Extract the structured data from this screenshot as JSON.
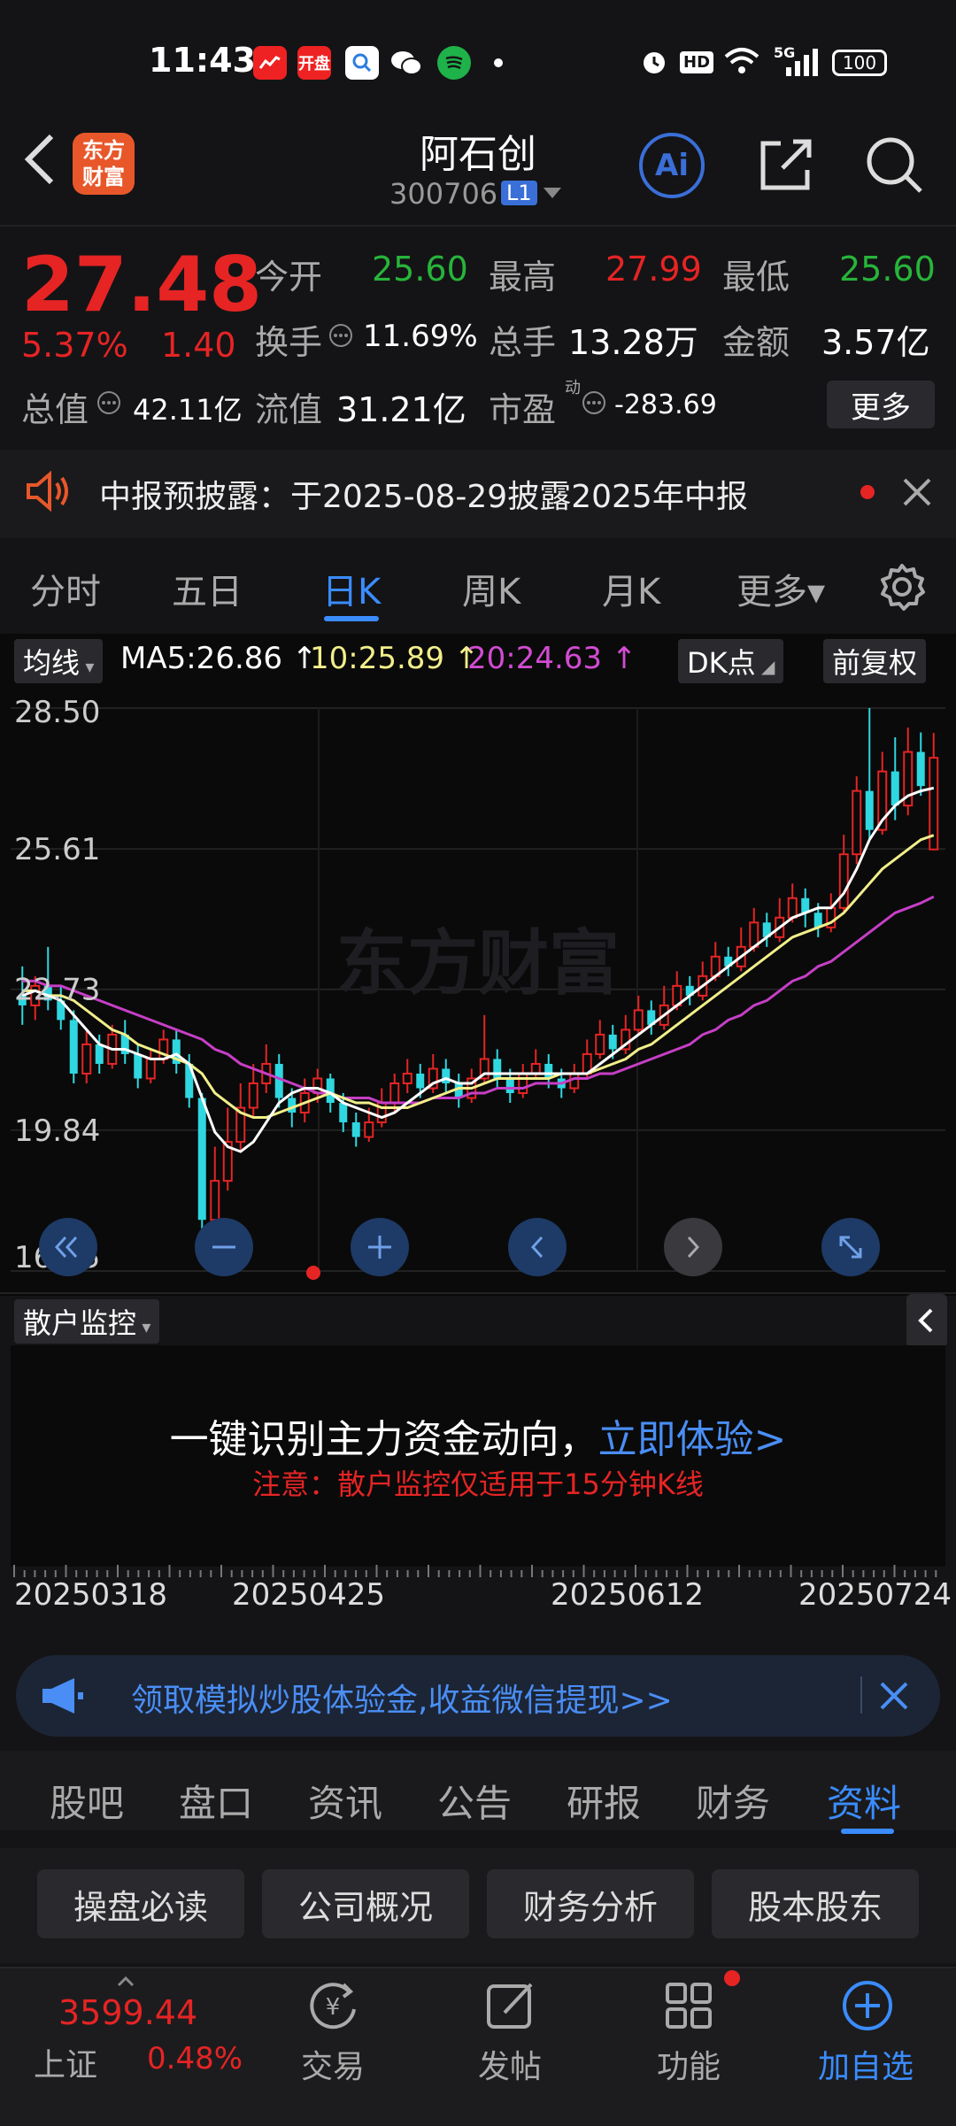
{
  "status_bar": {
    "time": "11:43",
    "apps": [
      "开盘"
    ],
    "battery": "100",
    "hd": "HD",
    "signal": "5G"
  },
  "header": {
    "back_icon": "chevron-left-icon",
    "logo": "东方\n财富",
    "stock_name": "阿石创",
    "stock_code": "300706",
    "level_badge": "L1"
  },
  "quote": {
    "price": "27.48",
    "change_pct": "5.37%",
    "change_amt": "1.40",
    "today_open_label": "今开",
    "today_open": "25.60",
    "high_label": "最高",
    "high": "27.99",
    "low_label": "最低",
    "low": "25.60",
    "turnover_label": "换手",
    "turnover": "11.69%",
    "volume_label": "总手",
    "volume": "13.28万",
    "amount_label": "金额",
    "amount": "3.57亿",
    "total_mv_label": "总值",
    "total_mv": "42.11亿",
    "float_mv_label": "流值",
    "float_mv": "31.21亿",
    "pe_label": "市盈",
    "pe_sup": "动",
    "pe": "-283.69",
    "more": "更多"
  },
  "notice": {
    "text": "中报预披露：于2025-08-29披露2025年中报"
  },
  "chart_tabs": [
    {
      "label": "分时"
    },
    {
      "label": "五日"
    },
    {
      "label": "日K"
    },
    {
      "label": "周K"
    },
    {
      "label": "月K"
    },
    {
      "label": "更多▾"
    }
  ],
  "ma_bar": {
    "selector": "均线",
    "ma5": "MA5:26.86",
    "ma10": "10:25.89",
    "ma20": "20:24.63",
    "dk": "DK点",
    "adjust": "前复权"
  },
  "colors": {
    "up": "#e62424",
    "down": "#2fd7e0",
    "ma5": "#ffffff",
    "ma10": "#f2ee8a",
    "ma20": "#c63fc6",
    "accent": "#3a8cff"
  },
  "chart_data": {
    "type": "candlestick",
    "y_ticks": [
      "28.50",
      "25.61",
      "22.73",
      "19.84",
      "16.95"
    ],
    "ylim": [
      16.95,
      28.5
    ],
    "x_ticks": [
      "20250318",
      "20250425",
      "20250612",
      "20250724"
    ],
    "watermark": "东方财富",
    "candles": [
      [
        22.6,
        22.4,
        23.2,
        22.0
      ],
      [
        22.4,
        22.8,
        23.0,
        22.1
      ],
      [
        22.8,
        22.5,
        23.6,
        22.3
      ],
      [
        22.5,
        22.1,
        22.8,
        21.9
      ],
      [
        22.1,
        21.0,
        22.3,
        20.8
      ],
      [
        21.0,
        21.6,
        21.9,
        20.8
      ],
      [
        21.6,
        21.2,
        21.8,
        21.0
      ],
      [
        21.2,
        21.8,
        22.0,
        21.1
      ],
      [
        21.8,
        21.4,
        22.1,
        21.2
      ],
      [
        21.4,
        20.9,
        21.6,
        20.7
      ],
      [
        20.9,
        21.3,
        21.5,
        20.8
      ],
      [
        21.3,
        21.7,
        21.9,
        21.2
      ],
      [
        21.7,
        21.2,
        21.9,
        21.0
      ],
      [
        21.2,
        20.5,
        21.4,
        20.3
      ],
      [
        20.5,
        18.0,
        20.6,
        17.8
      ],
      [
        18.0,
        18.8,
        19.5,
        17.2
      ],
      [
        18.8,
        19.6,
        20.3,
        18.6
      ],
      [
        19.6,
        20.3,
        20.8,
        19.4
      ],
      [
        20.3,
        20.8,
        21.2,
        20.1
      ],
      [
        20.8,
        21.2,
        21.6,
        20.6
      ],
      [
        21.2,
        20.5,
        21.4,
        20.3
      ],
      [
        20.5,
        20.2,
        20.7,
        19.9
      ],
      [
        20.2,
        20.6,
        20.9,
        20.0
      ],
      [
        20.6,
        20.9,
        21.1,
        20.4
      ],
      [
        20.9,
        20.4,
        21.0,
        20.2
      ],
      [
        20.4,
        20.0,
        20.6,
        19.8
      ],
      [
        20.0,
        19.7,
        20.2,
        19.5
      ],
      [
        19.7,
        20.0,
        20.3,
        19.6
      ],
      [
        20.0,
        20.4,
        20.7,
        19.9
      ],
      [
        20.4,
        20.8,
        21.0,
        20.2
      ],
      [
        20.8,
        21.0,
        21.3,
        20.6
      ],
      [
        21.0,
        20.7,
        21.2,
        20.5
      ],
      [
        20.7,
        21.1,
        21.4,
        20.6
      ],
      [
        21.1,
        20.8,
        21.3,
        20.6
      ],
      [
        20.8,
        20.5,
        21.0,
        20.3
      ],
      [
        20.5,
        20.9,
        21.1,
        20.4
      ],
      [
        20.9,
        21.3,
        22.2,
        20.8
      ],
      [
        21.3,
        20.9,
        21.5,
        20.7
      ],
      [
        20.9,
        20.6,
        21.1,
        20.4
      ],
      [
        20.6,
        21.0,
        21.2,
        20.5
      ],
      [
        21.0,
        21.2,
        21.5,
        20.9
      ],
      [
        21.2,
        20.9,
        21.4,
        20.7
      ],
      [
        20.9,
        20.7,
        21.1,
        20.5
      ],
      [
        20.7,
        21.0,
        21.2,
        20.6
      ],
      [
        21.0,
        21.4,
        21.7,
        20.9
      ],
      [
        21.4,
        21.8,
        22.1,
        21.3
      ],
      [
        21.8,
        21.5,
        22.0,
        21.3
      ],
      [
        21.5,
        21.9,
        22.2,
        21.4
      ],
      [
        21.9,
        22.3,
        22.6,
        21.8
      ],
      [
        22.3,
        22.0,
        22.5,
        21.8
      ],
      [
        22.0,
        22.4,
        22.8,
        21.9
      ],
      [
        22.4,
        22.8,
        23.1,
        22.3
      ],
      [
        22.8,
        22.6,
        23.0,
        22.4
      ],
      [
        22.6,
        23.0,
        23.3,
        22.5
      ],
      [
        23.0,
        23.4,
        23.7,
        22.9
      ],
      [
        23.4,
        23.2,
        23.6,
        23.0
      ],
      [
        23.2,
        23.6,
        24.0,
        23.1
      ],
      [
        23.6,
        24.1,
        24.4,
        23.5
      ],
      [
        24.1,
        23.8,
        24.3,
        23.6
      ],
      [
        23.8,
        24.2,
        24.6,
        23.7
      ],
      [
        24.2,
        24.6,
        24.9,
        24.1
      ],
      [
        24.6,
        24.3,
        24.8,
        24.0
      ],
      [
        24.3,
        24.0,
        24.5,
        23.8
      ],
      [
        24.0,
        24.4,
        24.7,
        23.9
      ],
      [
        24.4,
        25.5,
        25.9,
        24.3
      ],
      [
        25.5,
        26.8,
        27.1,
        25.3
      ],
      [
        26.8,
        26.0,
        28.5,
        25.8
      ],
      [
        26.0,
        27.2,
        27.6,
        25.9
      ],
      [
        27.2,
        26.5,
        27.9,
        26.2
      ],
      [
        26.5,
        27.6,
        28.1,
        26.3
      ],
      [
        27.6,
        26.9,
        28.0,
        26.7
      ],
      [
        25.6,
        27.48,
        27.99,
        25.6
      ]
    ],
    "ma5": [
      22.6,
      22.7,
      22.6,
      22.5,
      22.2,
      21.9,
      21.6,
      21.5,
      21.5,
      21.4,
      21.3,
      21.3,
      21.4,
      21.2,
      20.5,
      19.8,
      19.5,
      19.4,
      19.6,
      20.0,
      20.4,
      20.6,
      20.7,
      20.7,
      20.6,
      20.4,
      20.3,
      20.2,
      20.1,
      20.2,
      20.4,
      20.6,
      20.8,
      20.9,
      20.8,
      20.8,
      21.0,
      21.0,
      21.0,
      21.0,
      21.0,
      21.0,
      21.0,
      21.0,
      21.0,
      21.2,
      21.4,
      21.6,
      21.8,
      22.0,
      22.2,
      22.4,
      22.6,
      22.8,
      23.0,
      23.2,
      23.4,
      23.6,
      23.8,
      24.0,
      24.2,
      24.3,
      24.4,
      24.4,
      24.7,
      25.2,
      25.8,
      26.2,
      26.5,
      26.7,
      26.8,
      26.86
    ],
    "ma10": [
      22.7,
      22.7,
      22.6,
      22.6,
      22.5,
      22.3,
      22.1,
      21.9,
      21.8,
      21.6,
      21.5,
      21.4,
      21.3,
      21.2,
      21.0,
      20.6,
      20.4,
      20.2,
      20.1,
      20.1,
      20.2,
      20.3,
      20.4,
      20.5,
      20.6,
      20.5,
      20.4,
      20.4,
      20.3,
      20.3,
      20.3,
      20.4,
      20.5,
      20.6,
      20.7,
      20.7,
      20.8,
      20.9,
      20.9,
      20.9,
      20.9,
      20.9,
      21.0,
      21.0,
      21.0,
      21.1,
      21.2,
      21.3,
      21.5,
      21.6,
      21.8,
      22.0,
      22.2,
      22.4,
      22.6,
      22.8,
      23.0,
      23.2,
      23.4,
      23.6,
      23.8,
      23.9,
      24.0,
      24.1,
      24.3,
      24.6,
      24.9,
      25.2,
      25.4,
      25.6,
      25.8,
      25.89
    ],
    "ma20": [
      22.9,
      22.9,
      22.8,
      22.8,
      22.7,
      22.6,
      22.5,
      22.4,
      22.3,
      22.2,
      22.1,
      22.0,
      21.9,
      21.8,
      21.7,
      21.5,
      21.4,
      21.2,
      21.1,
      21.0,
      20.9,
      20.8,
      20.7,
      20.6,
      20.6,
      20.5,
      20.5,
      20.5,
      20.4,
      20.4,
      20.4,
      20.4,
      20.5,
      20.5,
      20.5,
      20.6,
      20.6,
      20.7,
      20.7,
      20.7,
      20.8,
      20.8,
      20.8,
      20.9,
      20.9,
      21.0,
      21.0,
      21.1,
      21.2,
      21.3,
      21.4,
      21.5,
      21.6,
      21.8,
      21.9,
      22.1,
      22.2,
      22.4,
      22.5,
      22.7,
      22.9,
      23.0,
      23.2,
      23.3,
      23.5,
      23.7,
      23.9,
      24.1,
      24.3,
      24.4,
      24.5,
      24.63
    ]
  },
  "chart_controls": [
    "rewind",
    "zoom-out",
    "zoom-in",
    "prev",
    "next",
    "fullscreen"
  ],
  "sub_panel": {
    "selector": "散户监控",
    "main_text": "一键识别主力资金动向，",
    "link": "立即体验>",
    "warning": "注意：散户监控仅适用于15分钟K线"
  },
  "promo": {
    "text": "领取模拟炒股体验金,收益微信提现>>"
  },
  "info_tabs": [
    {
      "label": "股吧"
    },
    {
      "label": "盘口"
    },
    {
      "label": "资讯"
    },
    {
      "label": "公告"
    },
    {
      "label": "研报"
    },
    {
      "label": "财务"
    },
    {
      "label": "资料"
    }
  ],
  "info_chips": [
    {
      "label": "操盘必读"
    },
    {
      "label": "公司概况"
    },
    {
      "label": "财务分析"
    },
    {
      "label": "股本股东"
    }
  ],
  "nav": {
    "index_value": "3599.44",
    "index_name": "上证",
    "index_change": "0.48%",
    "items": [
      {
        "label": "交易",
        "icon": "trade-icon"
      },
      {
        "label": "发帖",
        "icon": "edit-icon"
      },
      {
        "label": "功能",
        "icon": "grid-icon"
      },
      {
        "label": "加自选",
        "icon": "add-circle-icon"
      }
    ]
  }
}
